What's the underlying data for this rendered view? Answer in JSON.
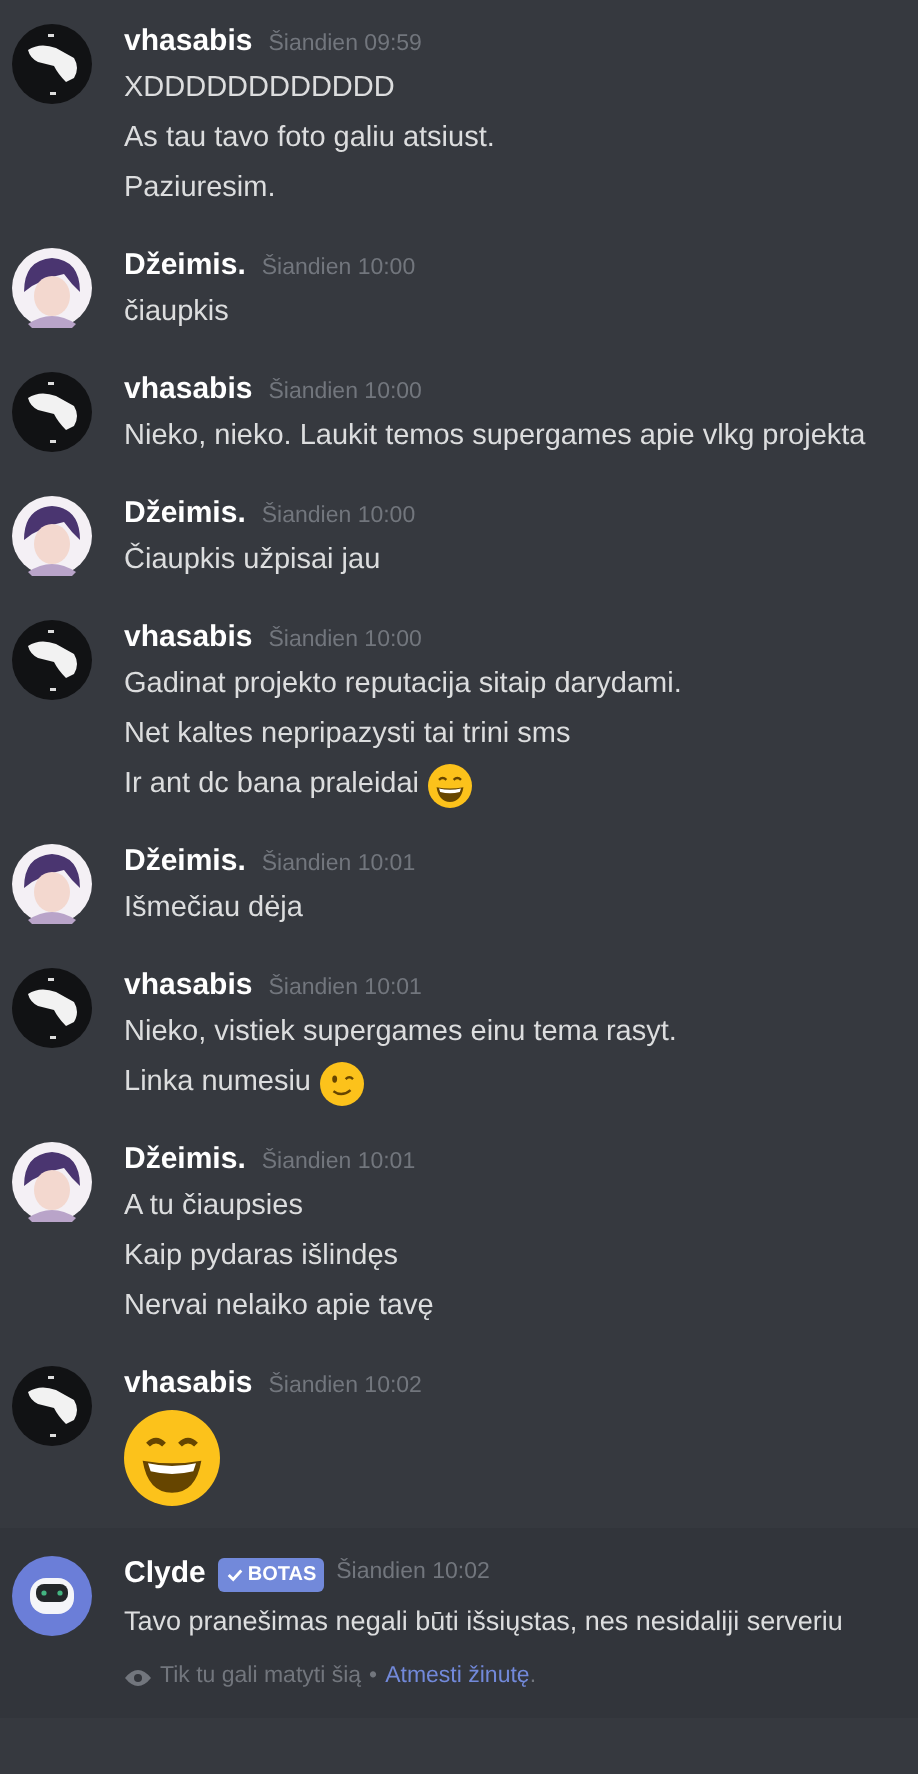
{
  "messages": [
    {
      "author": "vhasabis",
      "avatar": {
        "kind": "hand"
      },
      "time": "Šiandien 09:59",
      "lines": [
        {
          "text": "XDDDDDDDDDDDD"
        },
        {
          "text": "As tau tavo foto galiu atsiust."
        },
        {
          "text": "Paziuresim."
        }
      ]
    },
    {
      "author": "Džeimis.",
      "avatar": {
        "kind": "figure"
      },
      "time": "Šiandien 10:00",
      "lines": [
        {
          "text": "čiaupkis"
        }
      ]
    },
    {
      "author": "vhasabis",
      "avatar": {
        "kind": "hand"
      },
      "time": "Šiandien 10:00",
      "lines": [
        {
          "text": "Nieko, nieko. Laukit temos supergames apie vlkg projekta"
        }
      ]
    },
    {
      "author": "Džeimis.",
      "avatar": {
        "kind": "figure"
      },
      "time": "Šiandien 10:00",
      "lines": [
        {
          "text": "Čiaupkis užpisai jau"
        }
      ]
    },
    {
      "author": "vhasabis",
      "avatar": {
        "kind": "hand"
      },
      "time": "Šiandien 10:00",
      "lines": [
        {
          "text": "Gadinat projekto reputacija sitaip darydami."
        },
        {
          "text": "Net kaltes nepripazysti tai trini sms"
        },
        {
          "text": "Ir ant dc bana praleidai",
          "emoji": {
            "kind": "grin"
          }
        }
      ]
    },
    {
      "author": "Džeimis.",
      "avatar": {
        "kind": "figure"
      },
      "time": "Šiandien 10:01",
      "lines": [
        {
          "text": "Išmečiau dėja"
        }
      ]
    },
    {
      "author": "vhasabis",
      "avatar": {
        "kind": "hand"
      },
      "time": "Šiandien 10:01",
      "lines": [
        {
          "text": "Nieko, vistiek supergames einu tema rasyt."
        },
        {
          "text": "Linka numesiu",
          "emoji": {
            "kind": "wink"
          }
        }
      ]
    },
    {
      "author": "Džeimis.",
      "avatar": {
        "kind": "figure"
      },
      "time": "Šiandien 10:01",
      "lines": [
        {
          "text": "A tu čiaupsies"
        },
        {
          "text": "Kaip pydaras išlindęs"
        },
        {
          "text": "Nervai nelaiko apie tavę"
        }
      ]
    },
    {
      "author": "vhasabis",
      "avatar": {
        "kind": "hand"
      },
      "time": "Šiandien 10:02",
      "lines": [
        {
          "jumbo_emoji": {
            "kind": "grin"
          }
        }
      ]
    }
  ],
  "bot_message": {
    "author": "Clyde",
    "avatar": {
      "kind": "robot"
    },
    "badge": "BOTAS",
    "time": "Šiandien 10:02",
    "text": "Tavo pranešimas negali būti išsiųstas, nes nesidaliji serveriu",
    "notice": "Tik tu gali matyti šią",
    "separator": "•",
    "dismiss_link": "Atmesti žinutę",
    "dismiss_end": "."
  }
}
